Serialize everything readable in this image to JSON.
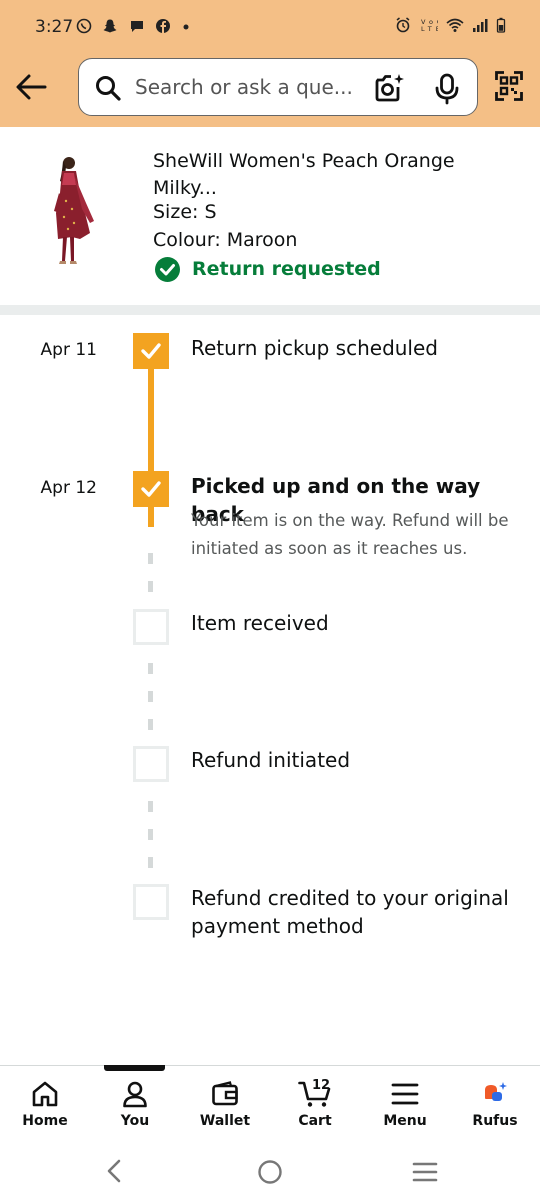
{
  "status_bar": {
    "time": "3:27",
    "left_icons": [
      "whatsapp-icon",
      "snapchat-icon",
      "chat-icon",
      "facebook-icon",
      "dot-icon"
    ],
    "right_icons": [
      "alarm-icon",
      "volte-icon",
      "wifi-icon",
      "signal-icon",
      "battery-icon"
    ]
  },
  "header": {
    "background": "#f4bf86",
    "search_placeholder": "Search or ask a que..."
  },
  "product": {
    "title": "SheWill Women's Peach Orange Milky...",
    "size": "Size: S",
    "colour": "Colour: Maroon",
    "status": "Return requested",
    "status_color": "#067d3a"
  },
  "timeline": {
    "accent": "#f3a320",
    "steps": [
      {
        "date": "Apr 11",
        "label": "Return pickup scheduled",
        "done": true
      },
      {
        "date": "Apr 12",
        "label": "Picked up and on the way back",
        "done": true,
        "description": "Your item is on the way. Refund will be initiated as soon as it reaches us."
      },
      {
        "date": "",
        "label": "Item received",
        "done": false
      },
      {
        "date": "",
        "label": "Refund initiated",
        "done": false
      },
      {
        "date": "",
        "label": "Refund credited to your original payment method",
        "done": false
      }
    ]
  },
  "bottom_nav": {
    "items": [
      {
        "label": "Home",
        "icon": "home-icon"
      },
      {
        "label": "You",
        "icon": "user-icon",
        "active": true
      },
      {
        "label": "Wallet",
        "icon": "wallet-icon"
      },
      {
        "label": "Cart",
        "icon": "cart-icon"
      },
      {
        "label": "Menu",
        "icon": "menu-icon"
      },
      {
        "label": "Rufus",
        "icon": "rufus-icon"
      }
    ],
    "cart_count": "12"
  }
}
